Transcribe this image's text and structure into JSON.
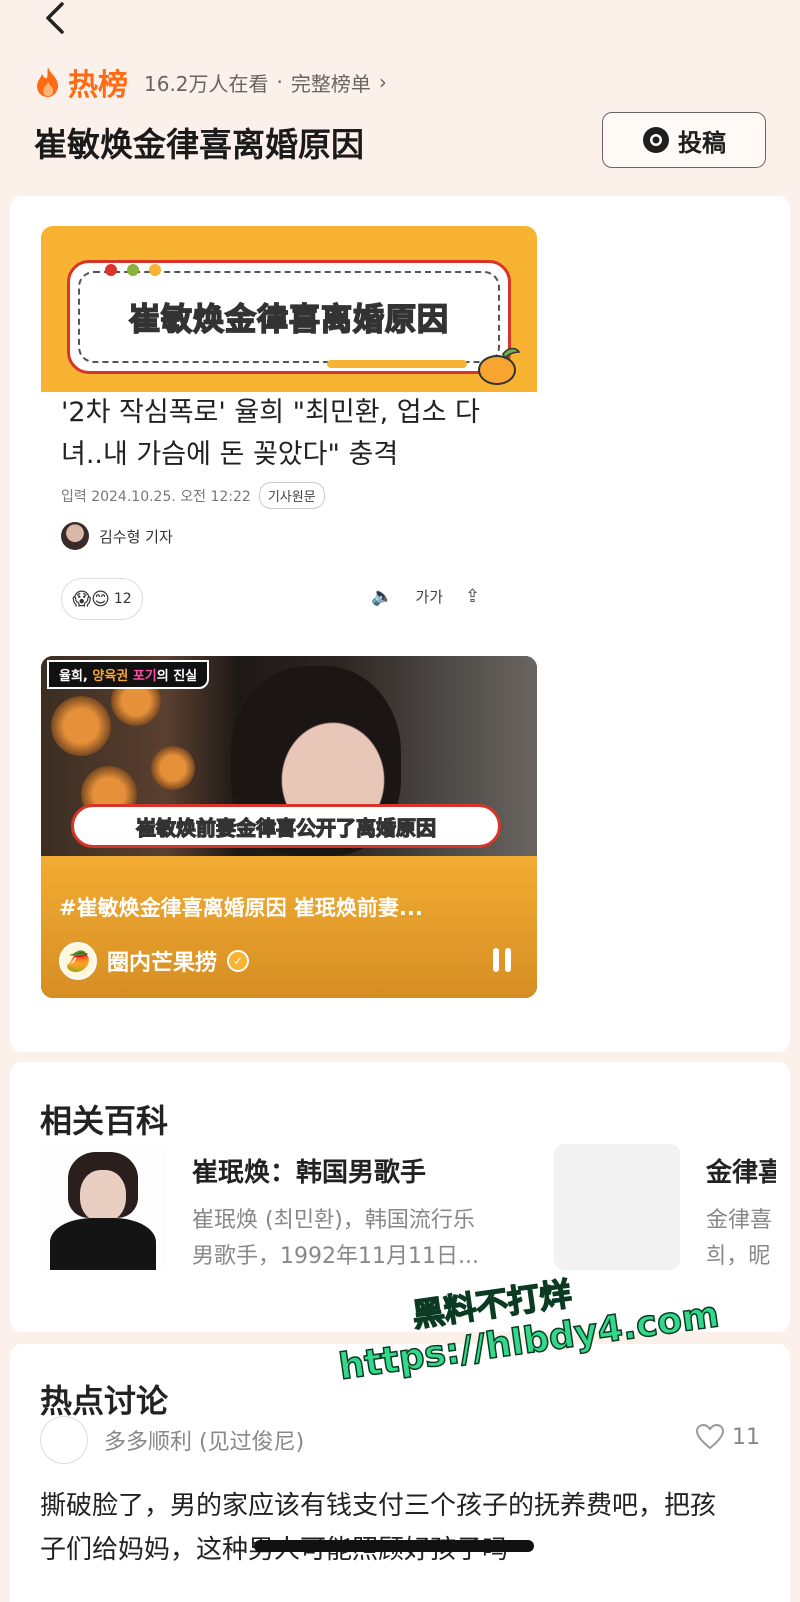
{
  "header": {
    "hot_label": "热榜",
    "viewers": "16.2万人在看",
    "dot": "·",
    "full_list": "完整榜单",
    "topic_title": "崔敏焕金律喜离婚原因",
    "submit_label": "投稿"
  },
  "article": {
    "banner_text": "崔敏焕金律喜离婚原因",
    "headline": "'2차 작심폭로' 율희 \"최민환, 업소 다녀..내 가슴에 돈 꽂았다\" 충격",
    "date": "입력 2024.10.25. 오전 12:22",
    "original_label": "기사원문",
    "reporter": "김수형 기자",
    "reaction_emojis": "😱😊",
    "reaction_count": "12",
    "tools": [
      "🔈",
      "가가",
      "⇪"
    ]
  },
  "video": {
    "corner_tag_1": "율희, ",
    "corner_tag_2": "양육권",
    "corner_tag_3": "포기",
    "corner_tag_4": "의 진실",
    "subtitle": "崔敏焕前妻金律喜公开了离婚原因",
    "title": "#崔敏焕金律喜离婚原因 崔珉焕前妻...",
    "author": "圈内芒果捞"
  },
  "baike": {
    "section_title": "相关百科",
    "items": [
      {
        "name": "崔珉焕：韩国男歌手",
        "desc_line1": "崔珉焕 (최민환)，韩国流行乐",
        "desc_line2": "男歌手，1992年11月11日..."
      },
      {
        "name": "金律喜",
        "desc_line1": "金律喜",
        "desc_line2": "희，昵"
      }
    ]
  },
  "discussion": {
    "section_title": "热点讨论",
    "user": "多多顺利 (见过俊尼)",
    "likes": "11",
    "text": "撕破脸了，男的家应该有钱支付三个孩子的抚养费吧，把孩子们给妈妈，这种男人可能照顾好孩子吗"
  },
  "watermark": {
    "line1": "黑料不打烊",
    "line2": "https://hlbdy4.com"
  },
  "colors": {
    "accent": "#ff6a14",
    "banner_orange": "#f7b331",
    "page_bg": "#fbf1ea",
    "watermark_green": "#33d98a"
  }
}
